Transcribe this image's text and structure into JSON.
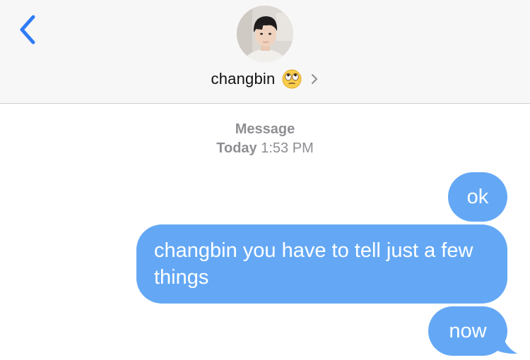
{
  "header": {
    "contact_name": "changbin",
    "contact_emoji": "face-with-rolling-eyes-emoji",
    "back_icon": "chevron-left-icon",
    "details_icon": "chevron-right-icon",
    "avatar": "contact-avatar-photo"
  },
  "thread_meta": {
    "service": "Message",
    "day": "Today",
    "time": "1:53 PM"
  },
  "messages": [
    {
      "text": "ok",
      "direction": "outgoing"
    },
    {
      "text": "changbin you have to tell just a few things",
      "direction": "outgoing"
    },
    {
      "text": "now",
      "direction": "outgoing"
    }
  ],
  "colors": {
    "accent": "#2f7cf6",
    "bubble": "#64a8f5",
    "header_bg": "#f7f7f7",
    "meta_text": "#8e8e93"
  }
}
